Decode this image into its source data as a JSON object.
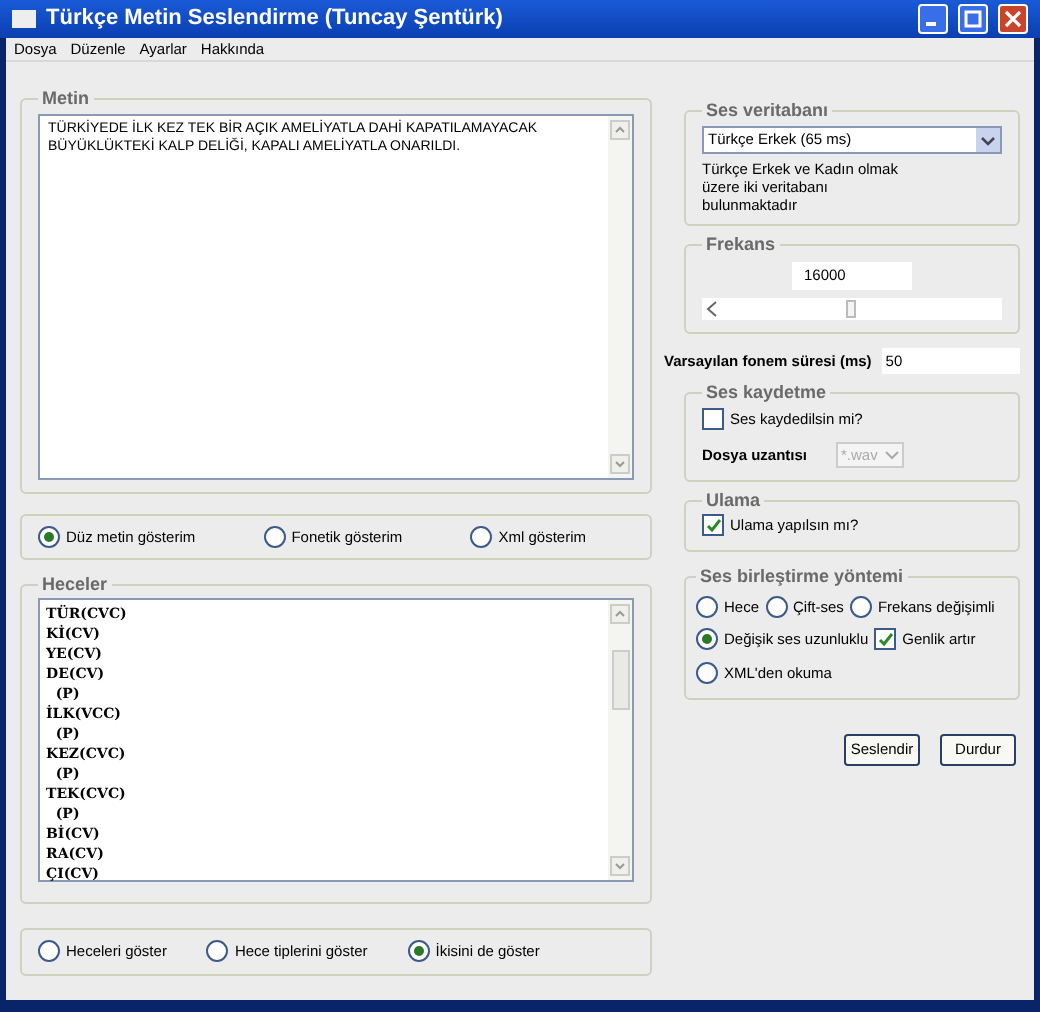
{
  "window": {
    "title": "Türkçe Metin Seslendirme (Tuncay Şentürk)"
  },
  "menu": [
    "Dosya",
    "Düzenle",
    "Ayarlar",
    "Hakkında"
  ],
  "metin": {
    "title": "Metin",
    "value": "TÜRKİYEDE İLK KEZ TEK BİR AÇIK AMELİYATLA DAHİ KAPATILAMAYACAK BÜYÜKLÜKTEKİ KALP DELİĞİ, KAPALI AMELİYATLA ONARILDI."
  },
  "display_options": [
    {
      "label": "Düz metin gösterim",
      "selected": true
    },
    {
      "label": "Fonetik gösterim",
      "selected": false
    },
    {
      "label": "Xml gösterim",
      "selected": false
    }
  ],
  "heceler": {
    "title": "Heceler",
    "lines": [
      "TÜR(CVC)",
      "Kİ(CV)",
      "YE(CV)",
      "DE(CV)",
      "  (P)",
      "İLK(VCC)",
      "  (P)",
      "KEZ(CVC)",
      "  (P)",
      "TEK(CVC)",
      "  (P)",
      "Bİ(CV)",
      "RA(CV)",
      "ÇI(CV)"
    ]
  },
  "syllable_options": [
    {
      "label": "Heceleri göster",
      "selected": false
    },
    {
      "label": "Hece tiplerini göster",
      "selected": false
    },
    {
      "label": "İkisini de göster",
      "selected": true
    }
  ],
  "ses_veritabani": {
    "title": "Ses veritabanı",
    "value": "Türkçe Erkek (65 ms)",
    "note": "Türkçe Erkek ve Kadın olmak üzere iki veritabanı bulunmaktadır"
  },
  "frekans": {
    "title": "Frekans",
    "value": "16000",
    "level": 0.5
  },
  "default_duration": {
    "label": "Varsayılan fonem süresi (ms)",
    "value": "50"
  },
  "ses_kaydetme": {
    "title": "Ses kaydetme",
    "checkbox": {
      "label": "Ses kaydedilsin mi?",
      "checked": false
    },
    "extension_label": "Dosya uzantısı",
    "extension": {
      "value": "*.wav",
      "disabled": true
    }
  },
  "ulama": {
    "title": "Ulama",
    "checkbox": {
      "label": "Ulama yapılsın mı?",
      "checked": true
    }
  },
  "method": {
    "title": "Ses birleştirme yöntemi",
    "options": [
      {
        "kind": "radio",
        "label": "Hece",
        "selected": false
      },
      {
        "kind": "radio",
        "label": "Çift-ses",
        "selected": false
      },
      {
        "kind": "radio",
        "label": "Frekans değişimli",
        "selected": false
      },
      {
        "kind": "radio",
        "label": "Değişik ses uzunluklu",
        "selected": true
      },
      {
        "kind": "checkbox",
        "label": "Genlik artır",
        "checked": true
      },
      {
        "kind": "radio",
        "label": "XML'den okuma",
        "selected": false
      }
    ]
  },
  "buttons": [
    "Seslendir",
    "Durdur"
  ]
}
